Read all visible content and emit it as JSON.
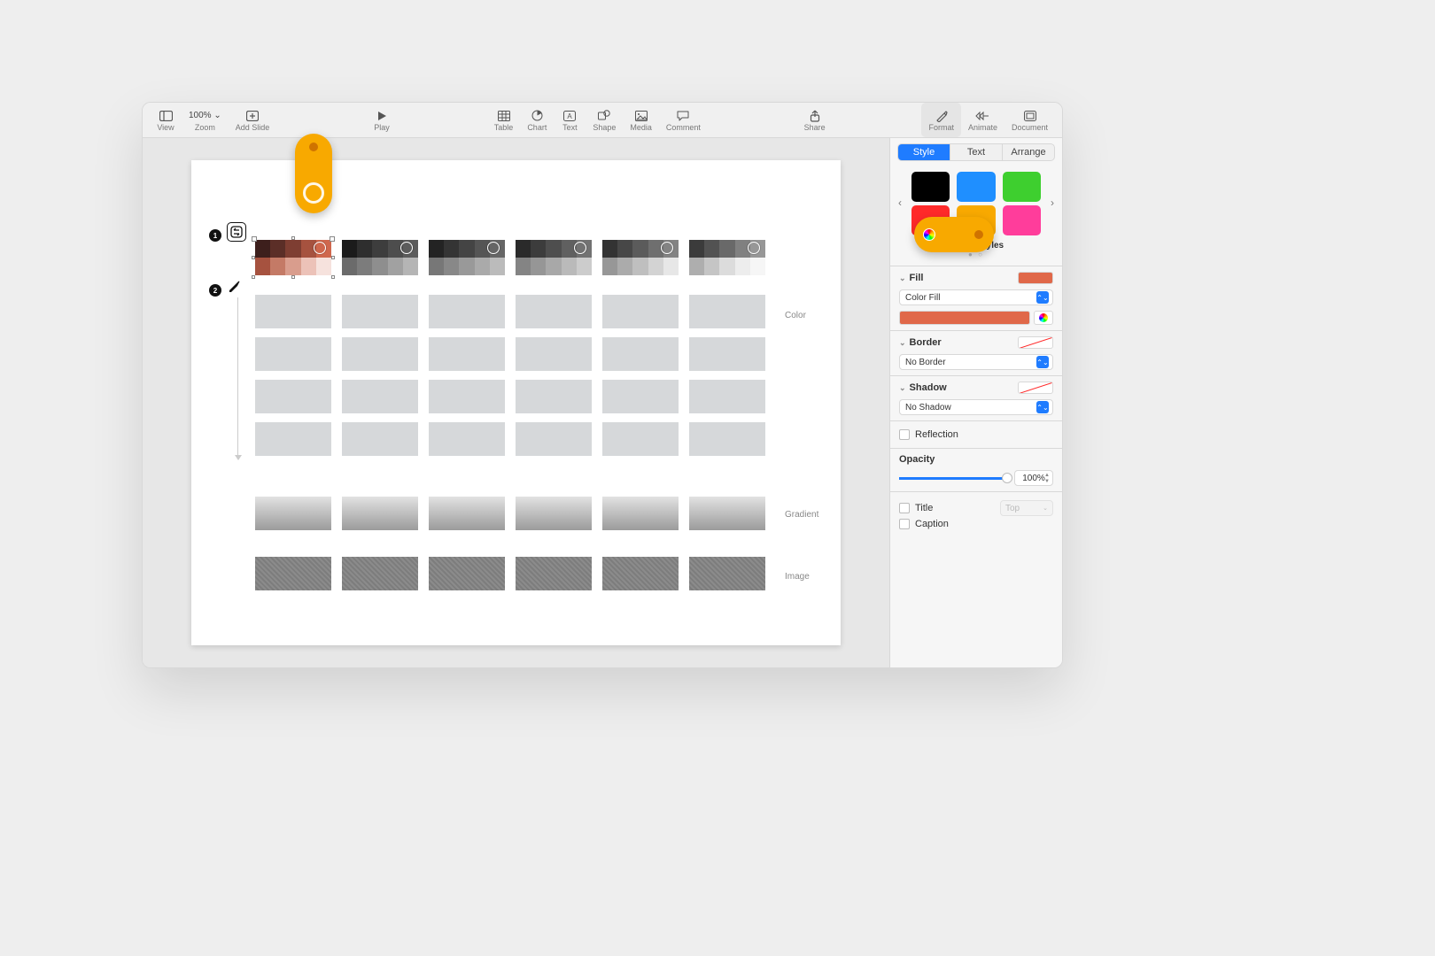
{
  "toolbar": {
    "view": "View",
    "zoom_value": "100% ⌄",
    "zoom": "Zoom",
    "add_slide": "Add Slide",
    "play": "Play",
    "table": "Table",
    "chart": "Chart",
    "text": "Text",
    "shape": "Shape",
    "media": "Media",
    "comment": "Comment",
    "share": "Share",
    "format": "Format",
    "animate": "Animate",
    "document": "Document"
  },
  "sidebar": {
    "tabs": {
      "style": "Style",
      "text": "Text",
      "arrange": "Arrange"
    },
    "shape_styles_label": "Shape Styles",
    "style_colors": [
      "#000000",
      "#1f8fff",
      "#3ecf2f",
      "#ff2a2a",
      "#f8a900",
      "#ff3d9b"
    ],
    "fill": {
      "label": "Fill",
      "type_label": "Color Fill",
      "current_color": "#e06849"
    },
    "border": {
      "label": "Border",
      "value": "No Border"
    },
    "shadow": {
      "label": "Shadow",
      "value": "No Shadow"
    },
    "reflection": {
      "label": "Reflection"
    },
    "opacity": {
      "label": "Opacity",
      "value": "100%"
    },
    "title": {
      "label": "Title",
      "position": "Top"
    },
    "caption": {
      "label": "Caption"
    }
  },
  "canvas": {
    "step1": "1",
    "step2": "2",
    "label_color": "Color",
    "label_gradient": "Gradient",
    "label_image": "Image",
    "palette_top": [
      "#3d1f1c",
      "#5b2e27",
      "#7e3e32",
      "#a6523f",
      "#cf674d"
    ],
    "palette_bottom": [
      "#a6523f",
      "#c47a66",
      "#d99d8d",
      "#ecc2b8",
      "#f6e2dd"
    ]
  }
}
